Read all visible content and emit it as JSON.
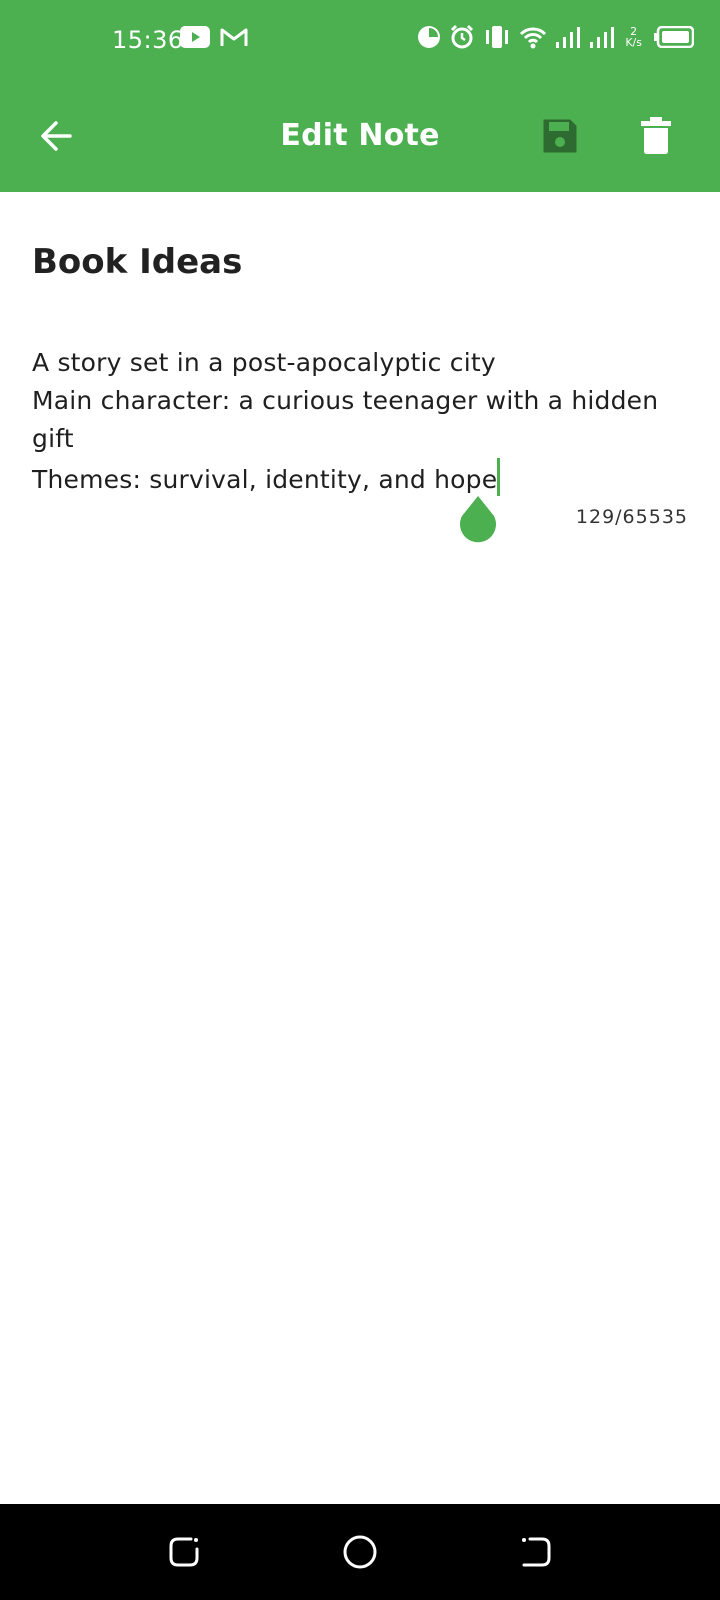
{
  "status_bar": {
    "time": "15:36",
    "net_speed_value": "2",
    "net_speed_unit": "K/s"
  },
  "app_bar": {
    "title": "Edit Note"
  },
  "note": {
    "title": "Book Ideas",
    "body_lines": [
      "A story set in a post-apocalyptic city",
      "Main character: a curious teenager with a hidden",
      "gift",
      "Themes: survival, identity, and hope"
    ],
    "char_count": "129/65535"
  },
  "colors": {
    "accent": "#4caf50",
    "save_icon": "#2e6b30"
  }
}
